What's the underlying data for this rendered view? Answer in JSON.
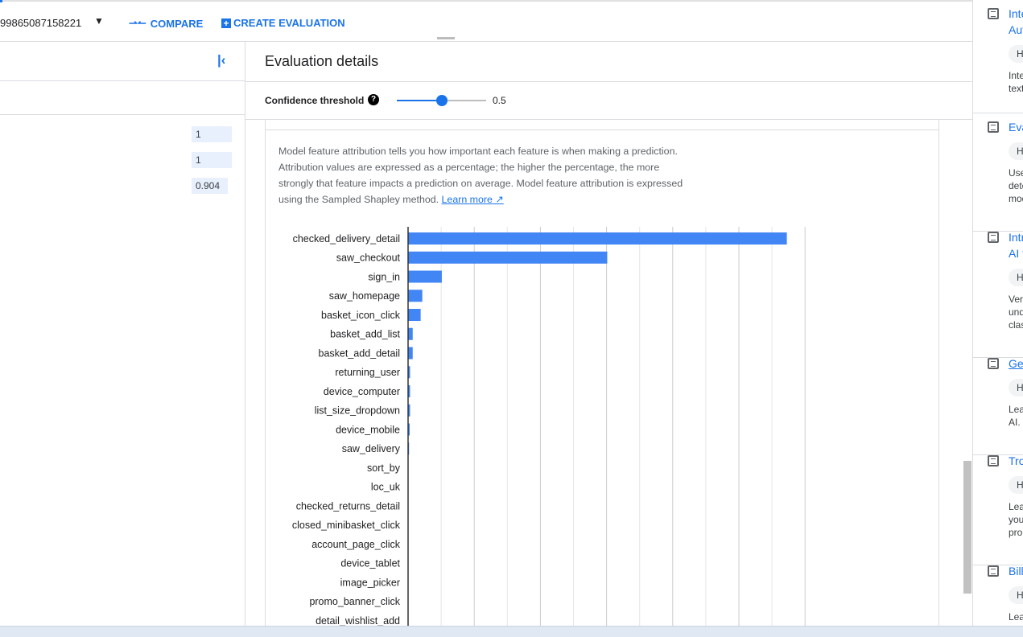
{
  "topbar": {
    "model_id": "99865087158221",
    "compare": "COMPARE",
    "create": "CREATE EVALUATION"
  },
  "left": {
    "values": [
      "1",
      "1",
      "0.904"
    ]
  },
  "main": {
    "title": "Evaluation details",
    "threshold_label": "Confidence threshold",
    "threshold_value": "0.5",
    "threshold_fraction": 0.5,
    "description": "Model feature attribution tells you how important each feature is when making a prediction. Attribution values are expressed as a percentage; the higher the percentage, the more strongly that feature impacts a prediction on average. Model feature attribution is expressed using the Sampled Shapley method.",
    "learn_more": "Learn more"
  },
  "chart_data": {
    "type": "bar",
    "orientation": "horizontal",
    "grid": true,
    "xlim": [
      0,
      12
    ],
    "bar_color": "#4285f4",
    "categories": [
      "checked_delivery_detail",
      "saw_checkout",
      "sign_in",
      "saw_homepage",
      "basket_icon_click",
      "basket_add_list",
      "basket_add_detail",
      "returning_user",
      "device_computer",
      "list_size_dropdown",
      "device_mobile",
      "saw_delivery",
      "sort_by",
      "loc_uk",
      "checked_returns_detail",
      "closed_minibasket_click",
      "account_page_click",
      "device_tablet",
      "image_picker",
      "promo_banner_click",
      "detail_wishlist_add"
    ],
    "values": [
      11.45,
      6.02,
      1.02,
      0.43,
      0.38,
      0.14,
      0.14,
      0.06,
      0.06,
      0.06,
      0.05,
      0.03,
      0.01,
      0,
      0,
      0,
      0,
      0,
      0,
      0,
      0
    ]
  },
  "right": {
    "items": [
      {
        "title": "Inte",
        "title2": "Aut",
        "chip": "H",
        "desc": [
          "Inte",
          "text"
        ]
      },
      {
        "title": "Eva",
        "chip": "H",
        "desc": [
          "Use",
          "dete",
          "mod"
        ]
      },
      {
        "title": "Intr",
        "title2": "AI f",
        "chip": "H",
        "desc": [
          "Ver",
          "und",
          "clas"
        ]
      },
      {
        "title": "Get",
        "chip": "H",
        "desc": [
          "Lea",
          "AI."
        ]
      },
      {
        "title": "Tro",
        "chip": "H",
        "desc": [
          "Lea",
          "you",
          "pro"
        ]
      },
      {
        "title": "Bill",
        "chip": "H",
        "desc": [
          "Lea"
        ]
      }
    ]
  }
}
